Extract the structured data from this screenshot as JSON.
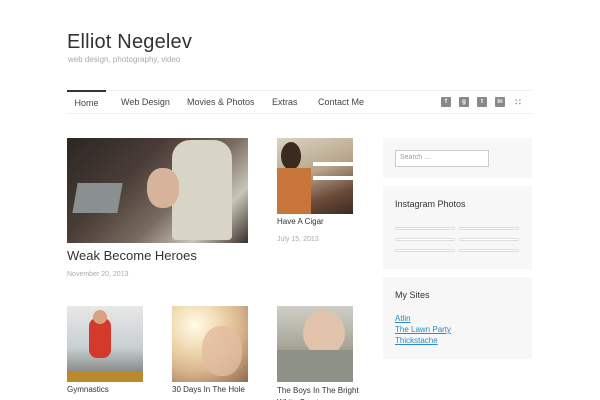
{
  "site": {
    "title": "Elliot Negelev",
    "tagline": "web design, photography, video"
  },
  "nav": {
    "items": [
      {
        "label": "Home",
        "active": true
      },
      {
        "label": "Web Design"
      },
      {
        "label": "Movies & Photos"
      },
      {
        "label": "Extras"
      },
      {
        "label": "Contact Me"
      }
    ],
    "social_icons": [
      "facebook-icon",
      "google-plus-icon",
      "twitter-icon",
      "linkedin-icon",
      "rss-icon"
    ]
  },
  "posts": [
    {
      "title": "Weak Become Heroes",
      "date": "November 20, 2013"
    },
    {
      "title": "Have A Cigar",
      "date": "July 15, 2013"
    },
    {
      "title": "Gymnastics"
    },
    {
      "title": "30 Days In The Hole"
    },
    {
      "title": "The Boys In The Bright White Sports"
    }
  ],
  "sidebar": {
    "search_placeholder": "Search ...",
    "instagram_title": "Instagram Photos",
    "sites_title": "My Sites",
    "sites": [
      "Atlin",
      "The Lawn Party",
      "Thickstache"
    ]
  },
  "colors": {
    "link": "#2a8bc6",
    "text": "#333333",
    "muted": "#aaaaaa"
  }
}
